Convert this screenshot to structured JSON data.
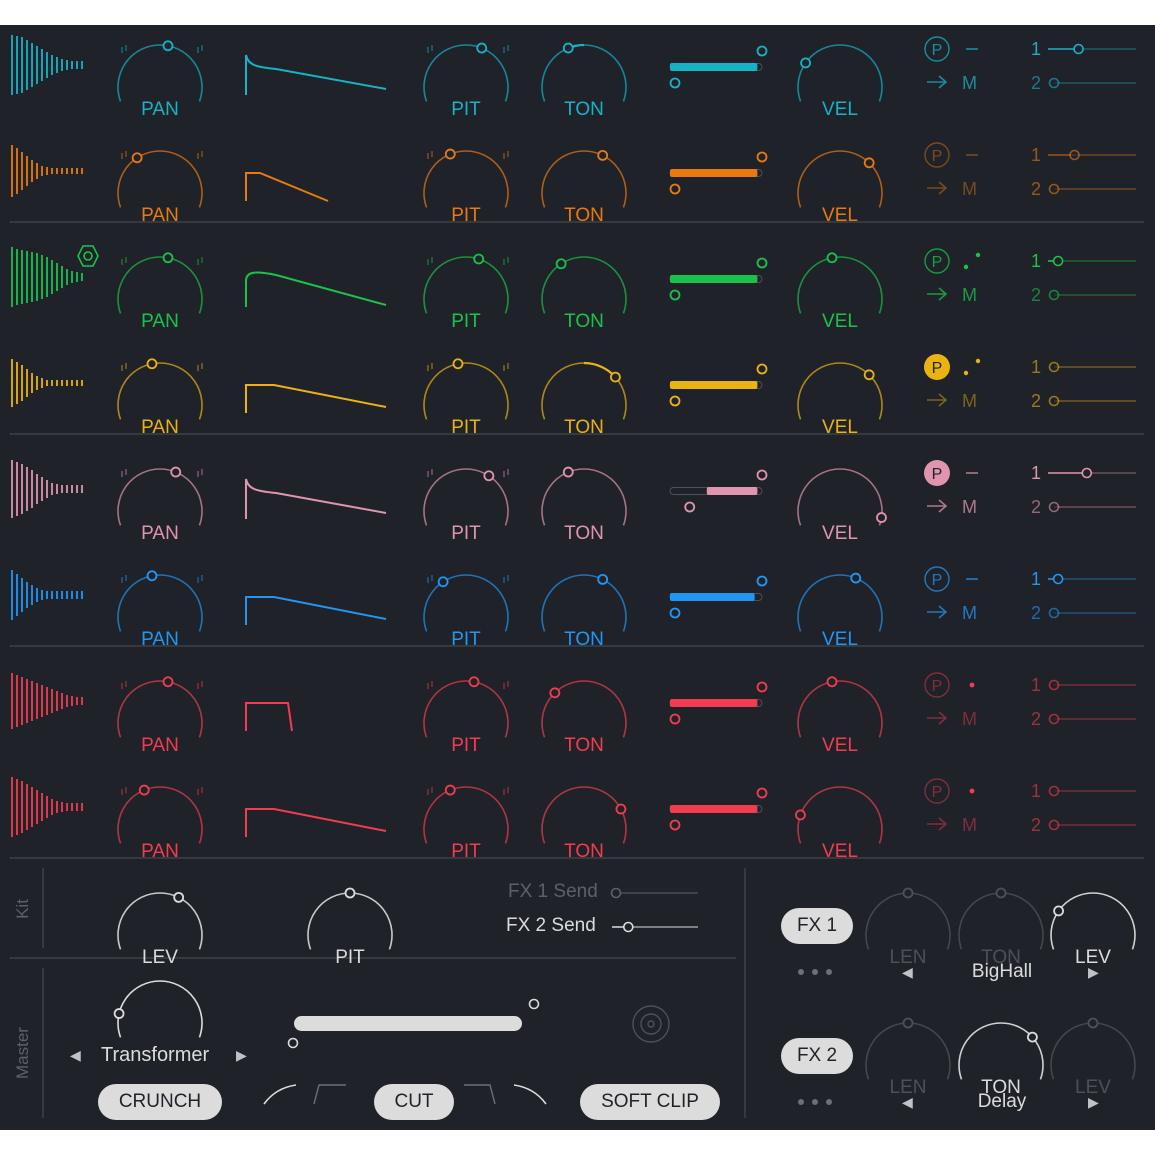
{
  "tracks": [
    {
      "color": "#16b2c6",
      "pan": 0.55,
      "pit": 0.6,
      "ton": 0.4,
      "vel": 0.25,
      "sample": 0.95,
      "bars": [
        60,
        58,
        56,
        50,
        44,
        38,
        32,
        26,
        20,
        16,
        12,
        10,
        8,
        8,
        8
      ],
      "env": "decay-slope",
      "mod": "dash",
      "p_style": "outline",
      "send1": 0.3,
      "send2": 0.0,
      "dim": false
    },
    {
      "color": "#e87a10",
      "pan": 0.35,
      "pit": 0.4,
      "ton": 0.62,
      "vel": 0.7,
      "sample": 0.95,
      "bars": [
        52,
        46,
        38,
        30,
        22,
        16,
        10,
        8,
        6,
        6,
        6,
        6,
        6,
        6,
        6
      ],
      "env": "short",
      "mod": "dash",
      "p_style": "outline",
      "send1": 0.25,
      "send2": 0.0,
      "dim": true
    },
    {
      "color": "#19c24a",
      "pan": 0.55,
      "pit": 0.58,
      "ton": 0.35,
      "vel": 0.45,
      "sample": 0.95,
      "bars": [
        60,
        56,
        54,
        52,
        50,
        48,
        44,
        40,
        34,
        28,
        22,
        16,
        12,
        10,
        8
      ],
      "env": "round-slope",
      "mod": "dots",
      "p_style": "outline",
      "send1": 0.05,
      "send2": 0.0,
      "dim": false
    },
    {
      "color": "#eab310",
      "pan": 0.45,
      "pit": 0.45,
      "ton": 0.72,
      "vel": 0.7,
      "sample": 0.95,
      "bars": [
        48,
        42,
        36,
        28,
        20,
        14,
        10,
        6,
        6,
        6,
        6,
        6,
        6,
        6,
        6
      ],
      "env": "flat-slope",
      "mod": "dots",
      "p_style": "filled",
      "send1": 0.0,
      "send2": 0.0,
      "dim": true
    },
    {
      "color": "#e094ae",
      "pan": 0.6,
      "pit": 0.65,
      "ton": 0.4,
      "vel": 0.95,
      "sample": 0.95,
      "range_start": 0.4,
      "bars": [
        58,
        54,
        50,
        44,
        38,
        30,
        24,
        18,
        12,
        10,
        8,
        8,
        8,
        8,
        8
      ],
      "env": "decay-slope",
      "mod": "dash",
      "p_style": "filled",
      "send1": 0.4,
      "send2": 0.0,
      "dim": false
    },
    {
      "color": "#2196f3",
      "pan": 0.45,
      "pit": 0.35,
      "ton": 0.62,
      "vel": 0.6,
      "sample": 0.92,
      "bars": [
        50,
        42,
        34,
        26,
        20,
        14,
        10,
        8,
        8,
        8,
        8,
        8,
        8,
        8,
        8
      ],
      "env": "flat-slope",
      "mod": "dash",
      "p_style": "outline",
      "send1": 0.05,
      "send2": 0.0,
      "dim": false
    },
    {
      "color": "#f23c4f",
      "pan": 0.55,
      "pit": 0.55,
      "ton": 0.3,
      "vel": 0.45,
      "sample": 0.95,
      "bars": [
        56,
        52,
        48,
        44,
        40,
        36,
        32,
        28,
        24,
        20,
        16,
        12,
        10,
        8,
        8
      ],
      "env": "gate",
      "mod": "dot",
      "p_style": "outline",
      "send1": 0.0,
      "send2": 0.0,
      "dim": true
    },
    {
      "color": "#f23c4f",
      "pan": 0.4,
      "pit": 0.4,
      "ton": 0.78,
      "vel": 0.18,
      "sample": 0.95,
      "bars": [
        60,
        56,
        52,
        46,
        40,
        34,
        28,
        22,
        16,
        12,
        10,
        8,
        8,
        8,
        8
      ],
      "env": "flat-slope",
      "mod": "dot",
      "p_style": "outline",
      "send1": 0.0,
      "send2": 0.0,
      "dim": true
    }
  ],
  "labels": {
    "pan": "PAN",
    "pit": "PIT",
    "ton": "TON",
    "vel": "VEL",
    "p": "P",
    "m": "M",
    "one": "1",
    "two": "2",
    "kit": "Kit",
    "master": "Master",
    "lev": "LEV",
    "len": "LEN"
  },
  "kit": {
    "lev": 0.62,
    "pit": 0.5,
    "fx1_send_label": "FX 1 Send",
    "fx2_send_label": "FX 2 Send",
    "fx1_send": 0.0,
    "fx2_send": 0.15
  },
  "master": {
    "drive": 0.15,
    "saturation": "Transformer",
    "range": 0.95,
    "crunch_label": "CRUNCH",
    "cut_label": "CUT",
    "soft_clip_label": "SOFT CLIP"
  },
  "fx": [
    {
      "label": "FX 1",
      "len": 0.5,
      "ton": 0.5,
      "lev": 0.25,
      "preset": "BigHall",
      "len_active": false,
      "ton_active": false,
      "lev_active": true
    },
    {
      "label": "FX 2",
      "len": 0.5,
      "ton": 0.72,
      "lev": 0.5,
      "preset": "Delay",
      "len_active": false,
      "ton_active": true,
      "lev_active": false
    }
  ],
  "theme": {
    "bg": "#1f2329",
    "divider": "#3c4249",
    "muted": "#4b5158",
    "light": "#dcdcdc"
  }
}
